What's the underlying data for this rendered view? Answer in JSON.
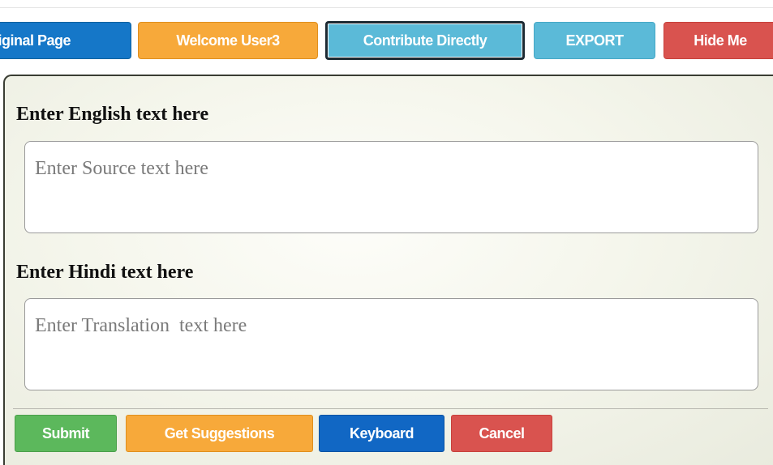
{
  "toolbar": {
    "original_page": "riginal Page",
    "welcome": "Welcome User3",
    "contribute": "Contribute Directly",
    "export": "EXPORT",
    "hide": "Hide Me"
  },
  "form": {
    "english_label": "Enter English text here",
    "source_placeholder": "Enter Source text here",
    "source_value": "",
    "hindi_label": "Enter Hindi text here",
    "translation_placeholder": "Enter Translation  text here",
    "translation_value": ""
  },
  "actions": {
    "submit": "Submit",
    "suggestions": "Get Suggestions",
    "keyboard": "Keyboard",
    "cancel": "Cancel"
  },
  "colors": {
    "blue": "#1577c8",
    "orange": "#f7a93a",
    "cyan": "#5bbad8",
    "red": "#d9534f",
    "green": "#5cb85c"
  }
}
